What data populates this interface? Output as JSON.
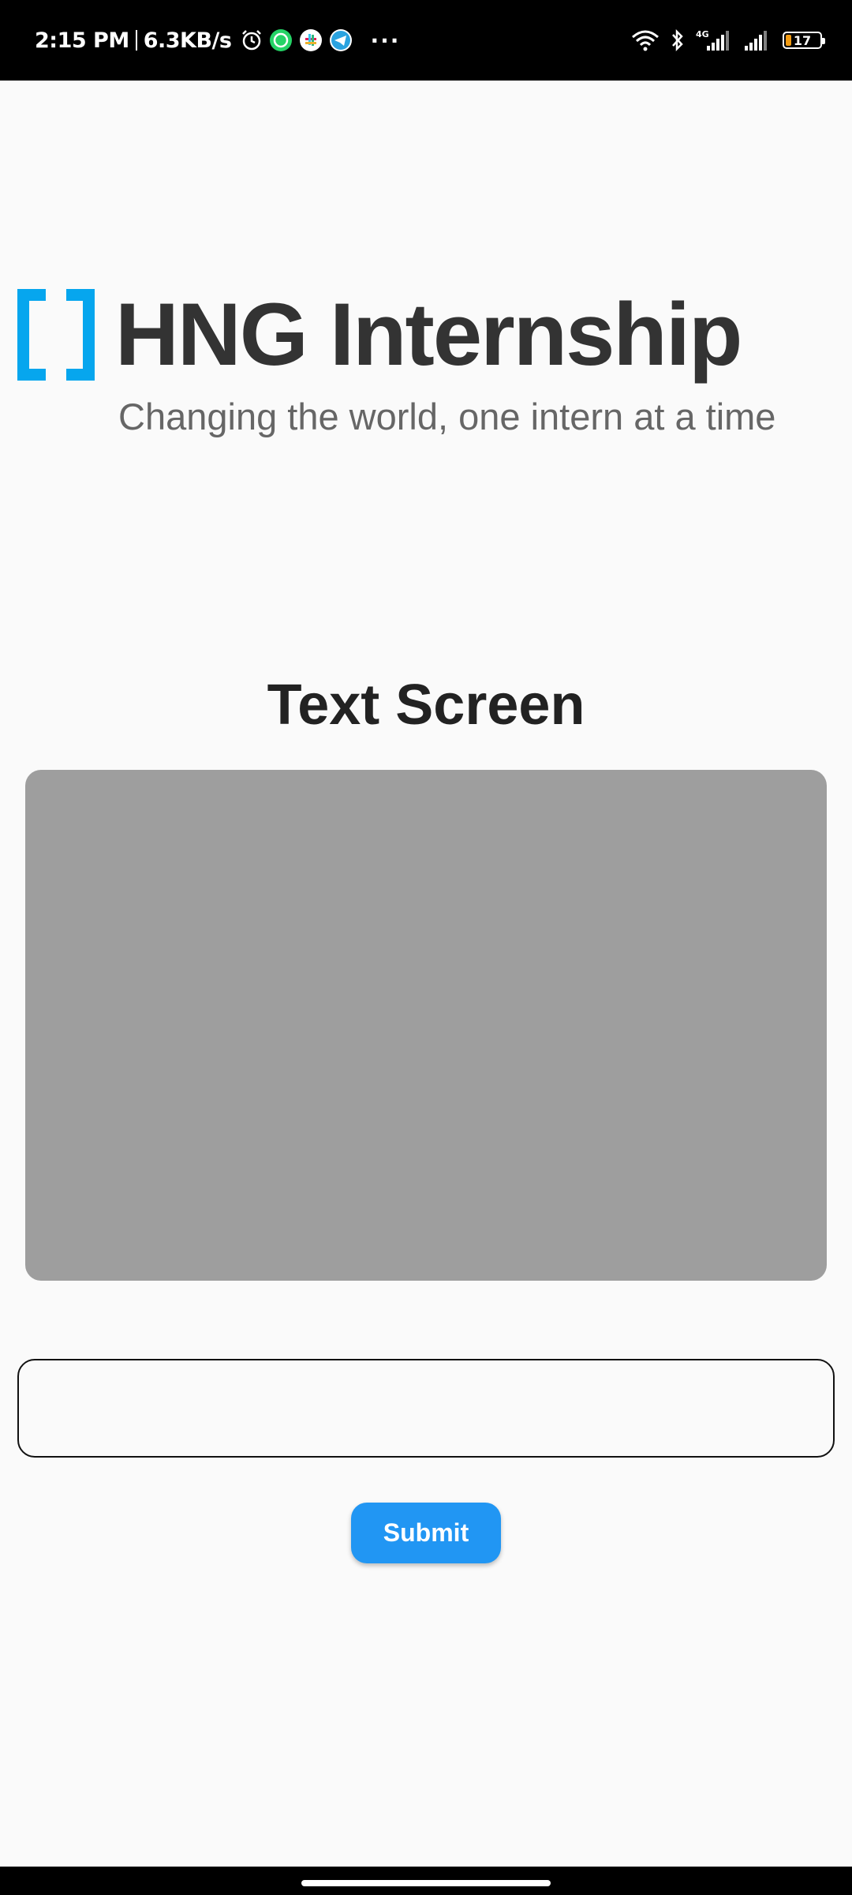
{
  "status_bar": {
    "time": "2:15 PM",
    "network_speed": "6.3KB/s",
    "notification_icons": [
      "alarm-icon",
      "whatsapp-icon",
      "slack-icon",
      "telegram-icon"
    ],
    "more_indicator": "···",
    "network_type": "4G",
    "battery_level": "17",
    "battery_fraction": 0.17,
    "battery_color": "#f39c12"
  },
  "logo": {
    "title": "HNG Internship",
    "tagline": "Changing the world, one intern at a time",
    "bracket_color": "#06a6ee"
  },
  "screen": {
    "title": "Text Screen",
    "display_text": ""
  },
  "input": {
    "value": "",
    "placeholder": ""
  },
  "submit_button": {
    "label": "Submit",
    "color": "#2196f3"
  }
}
